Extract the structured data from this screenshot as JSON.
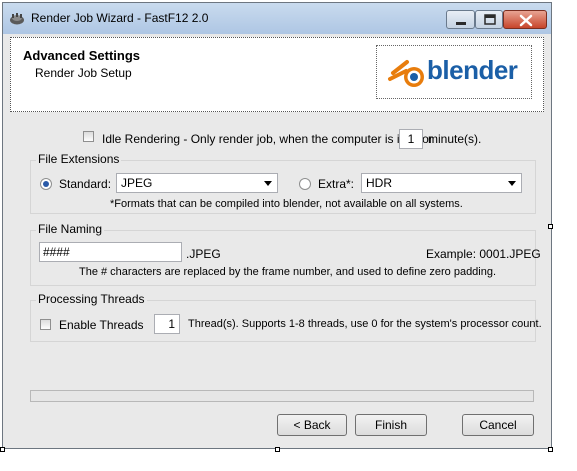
{
  "window": {
    "title": "Render Job Wizard - FastF12 2.0"
  },
  "header": {
    "title": "Advanced Settings",
    "subtitle": "Render Job Setup",
    "logo_text": "blender"
  },
  "idle": {
    "checked": false,
    "label": "Idle Rendering - Only render job, when the computer is idle for",
    "minutes_value": "1",
    "minutes_label": "minute(s)."
  },
  "file_extensions": {
    "group_label": "File Extensions",
    "standard_label": "Standard:",
    "standard_selected": true,
    "standard_value": "JPEG",
    "extra_label": "Extra*:",
    "extra_selected": false,
    "extra_value": "HDR",
    "note": "*Formats that can be compiled into blender, not available on all systems."
  },
  "file_naming": {
    "group_label": "File Naming",
    "pattern_value": "####",
    "extension_label": ".JPEG",
    "example_label": "Example: 0001.JPEG",
    "note": "The # characters are replaced by the frame number, and used to define zero padding."
  },
  "processing_threads": {
    "group_label": "Processing Threads",
    "enable_label": "Enable Threads",
    "enable_checked": false,
    "threads_value": "1",
    "threads_note": "Thread(s). Supports 1-8 threads, use 0 for the system's processor count."
  },
  "progress": {
    "value": 0
  },
  "buttons": {
    "back": "< Back",
    "finish": "Finish",
    "cancel": "Cancel"
  },
  "colors": {
    "titlebar": "#aec6e4",
    "logo_orange": "#e87d0d",
    "logo_blue": "#1b5fa7",
    "close_button": "#c7452b"
  }
}
